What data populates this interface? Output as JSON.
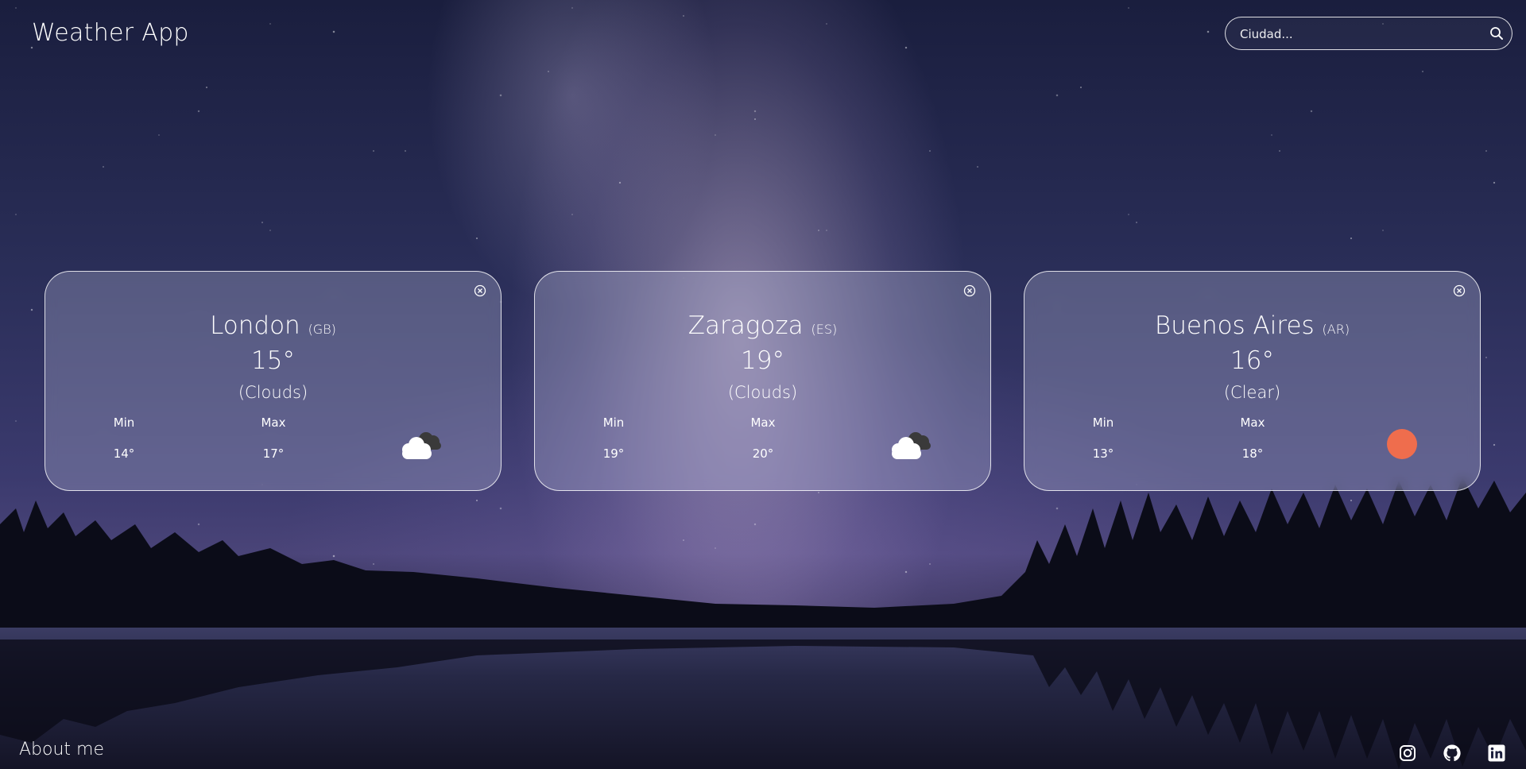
{
  "app": {
    "title": "Weather App"
  },
  "search": {
    "placeholder": "Ciudad..."
  },
  "cards": [
    {
      "city": "London",
      "country": "(GB)",
      "temp": "15°",
      "description": "(Clouds)",
      "min_label": "Min",
      "max_label": "Max",
      "min": "14°",
      "max": "17°",
      "icon": "cloud-icon"
    },
    {
      "city": "Zaragoza",
      "country": "(ES)",
      "temp": "19°",
      "description": "(Clouds)",
      "min_label": "Min",
      "max_label": "Max",
      "min": "19°",
      "max": "20°",
      "icon": "cloud-icon"
    },
    {
      "city": "Buenos Aires",
      "country": "(AR)",
      "temp": "16°",
      "description": "(Clear)",
      "min_label": "Min",
      "max_label": "Max",
      "min": "13°",
      "max": "18°",
      "icon": "sun-icon"
    }
  ],
  "footer": {
    "about_label": "About me",
    "social": [
      {
        "icon": "instagram-icon"
      },
      {
        "icon": "github-icon"
      },
      {
        "icon": "linkedin-icon"
      }
    ]
  },
  "colors": {
    "sun": "#ef6d4d",
    "card_border": "#ffffff",
    "cloud_front": "#ffffff",
    "cloud_back": "#3a3a3a"
  }
}
